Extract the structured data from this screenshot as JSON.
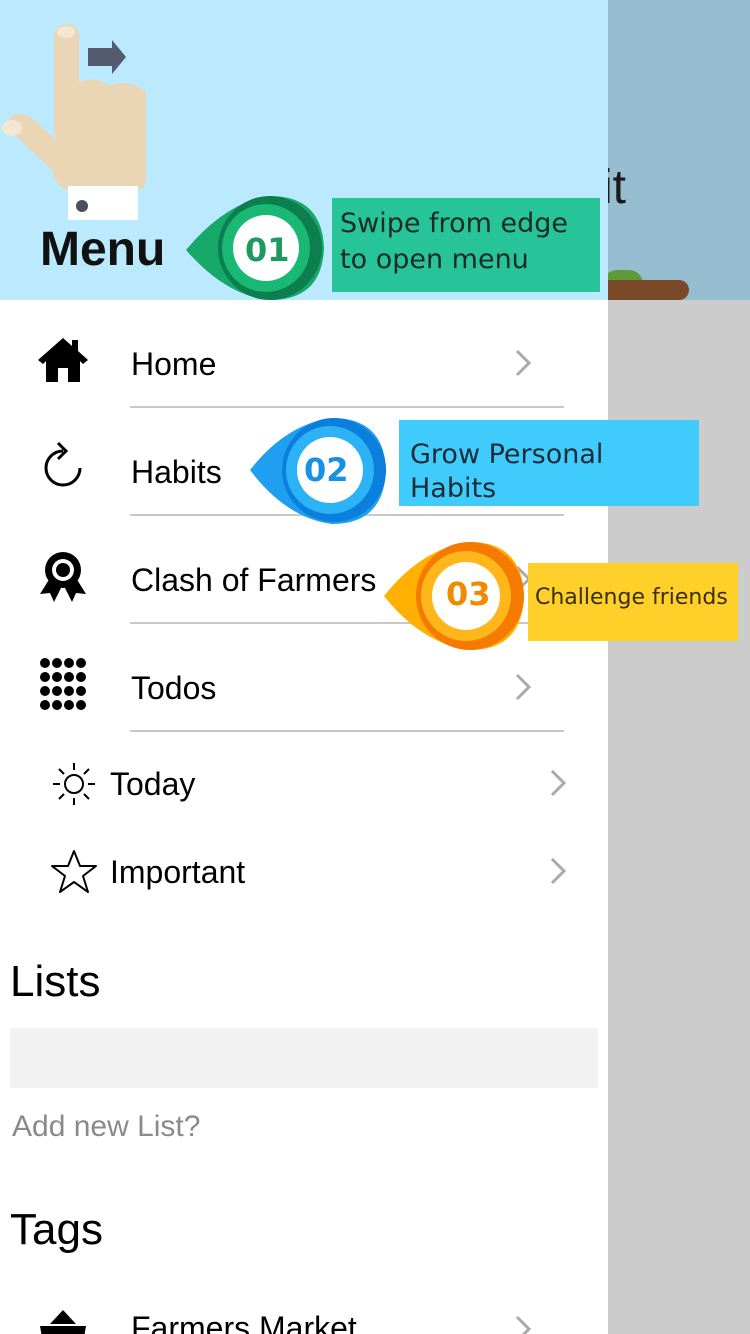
{
  "drawer": {
    "title": "Menu",
    "backdrop_partial_text": "it"
  },
  "tutorial": {
    "step1": {
      "number": "01",
      "text": "Swipe from edge to open menu",
      "color": "#27c499"
    },
    "step2": {
      "number": "02",
      "text": "Grow Personal Habits",
      "color": "#3fcbfc"
    },
    "step3": {
      "number": "03",
      "text": "Challenge friends",
      "color": "#ffd02a"
    }
  },
  "menu": {
    "items": [
      {
        "label": "Home",
        "icon": "home-icon"
      },
      {
        "label": "Habits",
        "icon": "refresh-icon"
      },
      {
        "label": "Clash of Farmers",
        "icon": "award-ribbon-icon"
      },
      {
        "label": "Todos",
        "icon": "grid-dots-icon"
      }
    ],
    "sub_items": [
      {
        "label": "Today",
        "icon": "sun-icon"
      },
      {
        "label": "Important",
        "icon": "star-icon"
      }
    ]
  },
  "lists": {
    "title": "Lists",
    "add_label": "Add new List?"
  },
  "tags": {
    "title": "Tags",
    "items": [
      {
        "label": "Farmers Market",
        "icon": "shop-basket-icon"
      }
    ]
  },
  "colors": {
    "header_bg": "#bbeafe",
    "backdrop_top": "#96bcd0",
    "backdrop_bottom": "#cccccc",
    "divider": "#c8c8c8",
    "chevron": "#aaaaaa"
  }
}
